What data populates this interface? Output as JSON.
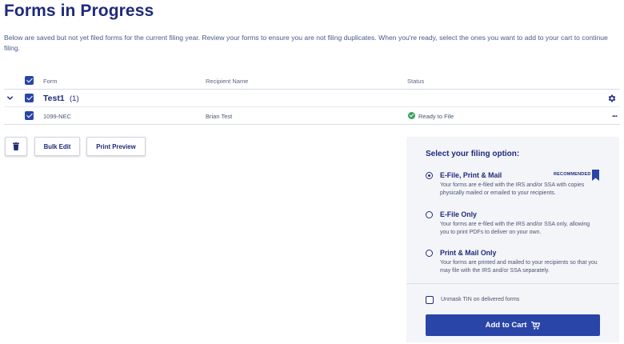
{
  "page": {
    "title": "Forms in Progress",
    "intro": "Below are saved but not yet filed forms for the current filing year. Review your forms to ensure you are not filing duplicates. When you're ready, select the ones you want to add to your cart to continue filing."
  },
  "table": {
    "columns": {
      "form": "Form",
      "recipient": "Recipient Name",
      "status": "Status"
    },
    "group": {
      "name": "Test1",
      "count": "(1)"
    },
    "rows": [
      {
        "form": "1099-NEC",
        "recipient": "Brian Test",
        "status": "Ready to File",
        "status_color": "#3aa35b"
      }
    ],
    "row_menu": "..."
  },
  "actions": {
    "delete_icon": "trash-icon",
    "bulk_edit": "Bulk Edit",
    "print_preview": "Print Preview"
  },
  "filing": {
    "title": "Select your filing option:",
    "options": [
      {
        "label": "E-File, Print & Mail",
        "badge": "RECOMMENDED",
        "selected": true,
        "description": "Your forms are e-filed with the IRS and/or SSA with copies physically mailed or emailed to your recipients."
      },
      {
        "label": "E-File Only",
        "selected": false,
        "description": "Your forms are e-filed with the IRS and/or SSA only, allowing you to print PDFs to deliver on your own."
      },
      {
        "label": "Print & Mail Only",
        "selected": false,
        "description": "Your forms are printed and mailed to your recipients so that you may file with the IRS and/or SSA separately."
      }
    ],
    "unmask_label": "Unmask TIN on delivered forms",
    "add_to_cart": "Add to Cart"
  },
  "colors": {
    "primary": "#2a45a8",
    "heading": "#1f2a7a",
    "success": "#3aa35b",
    "panel_bg": "#f4f5f9"
  }
}
